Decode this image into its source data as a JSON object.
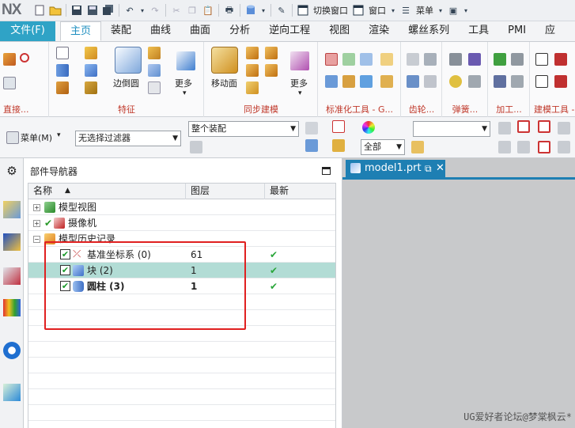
{
  "app": {
    "logo": "NX"
  },
  "qat": {
    "switch_window": "切换窗口",
    "window": "窗口",
    "menu": "菜单"
  },
  "tabs": [
    {
      "label": "文件(F)"
    },
    {
      "label": "主页"
    },
    {
      "label": "装配"
    },
    {
      "label": "曲线"
    },
    {
      "label": "曲面"
    },
    {
      "label": "分析"
    },
    {
      "label": "逆向工程"
    },
    {
      "label": "视图"
    },
    {
      "label": "渲染"
    },
    {
      "label": "螺丝系列"
    },
    {
      "label": "工具"
    },
    {
      "label": "PMI"
    },
    {
      "label": "应"
    }
  ],
  "ribbon": {
    "edge_blend": "边倒圆",
    "more1": "更多",
    "move_face": "移动面",
    "more2": "更多",
    "groups": {
      "direct": "直接...",
      "feature": "特征",
      "sync": "同步建模",
      "std_tools": "标准化工具 - G...",
      "gear": "齿轮...",
      "spring": "弹簧...",
      "machining": "加工...",
      "modeling_tools": "建模工具 -"
    }
  },
  "selbar": {
    "menu": "菜单(M)",
    "filter": "无选择过滤器",
    "scope": "整个装配",
    "all": "全部"
  },
  "navigator": {
    "title": "部件导航器",
    "columns": {
      "name": "名称",
      "layer": "图层",
      "recent": "最新"
    },
    "nodes": {
      "model_views": "模型视图",
      "cameras": "摄像机",
      "history": "模型历史记录"
    },
    "features": [
      {
        "name": "基准坐标系 (0)",
        "layer": "61",
        "recent": "✔",
        "bold": false,
        "selected": false
      },
      {
        "name": "块 (2)",
        "layer": "1",
        "recent": "✔",
        "bold": false,
        "selected": true
      },
      {
        "name": "圆柱 (3)",
        "layer": "1",
        "recent": "✔",
        "bold": true,
        "selected": false
      }
    ]
  },
  "viewport": {
    "tab": "model1.prt"
  },
  "watermark": "UG爱好者论坛@梦棠枫云*"
}
